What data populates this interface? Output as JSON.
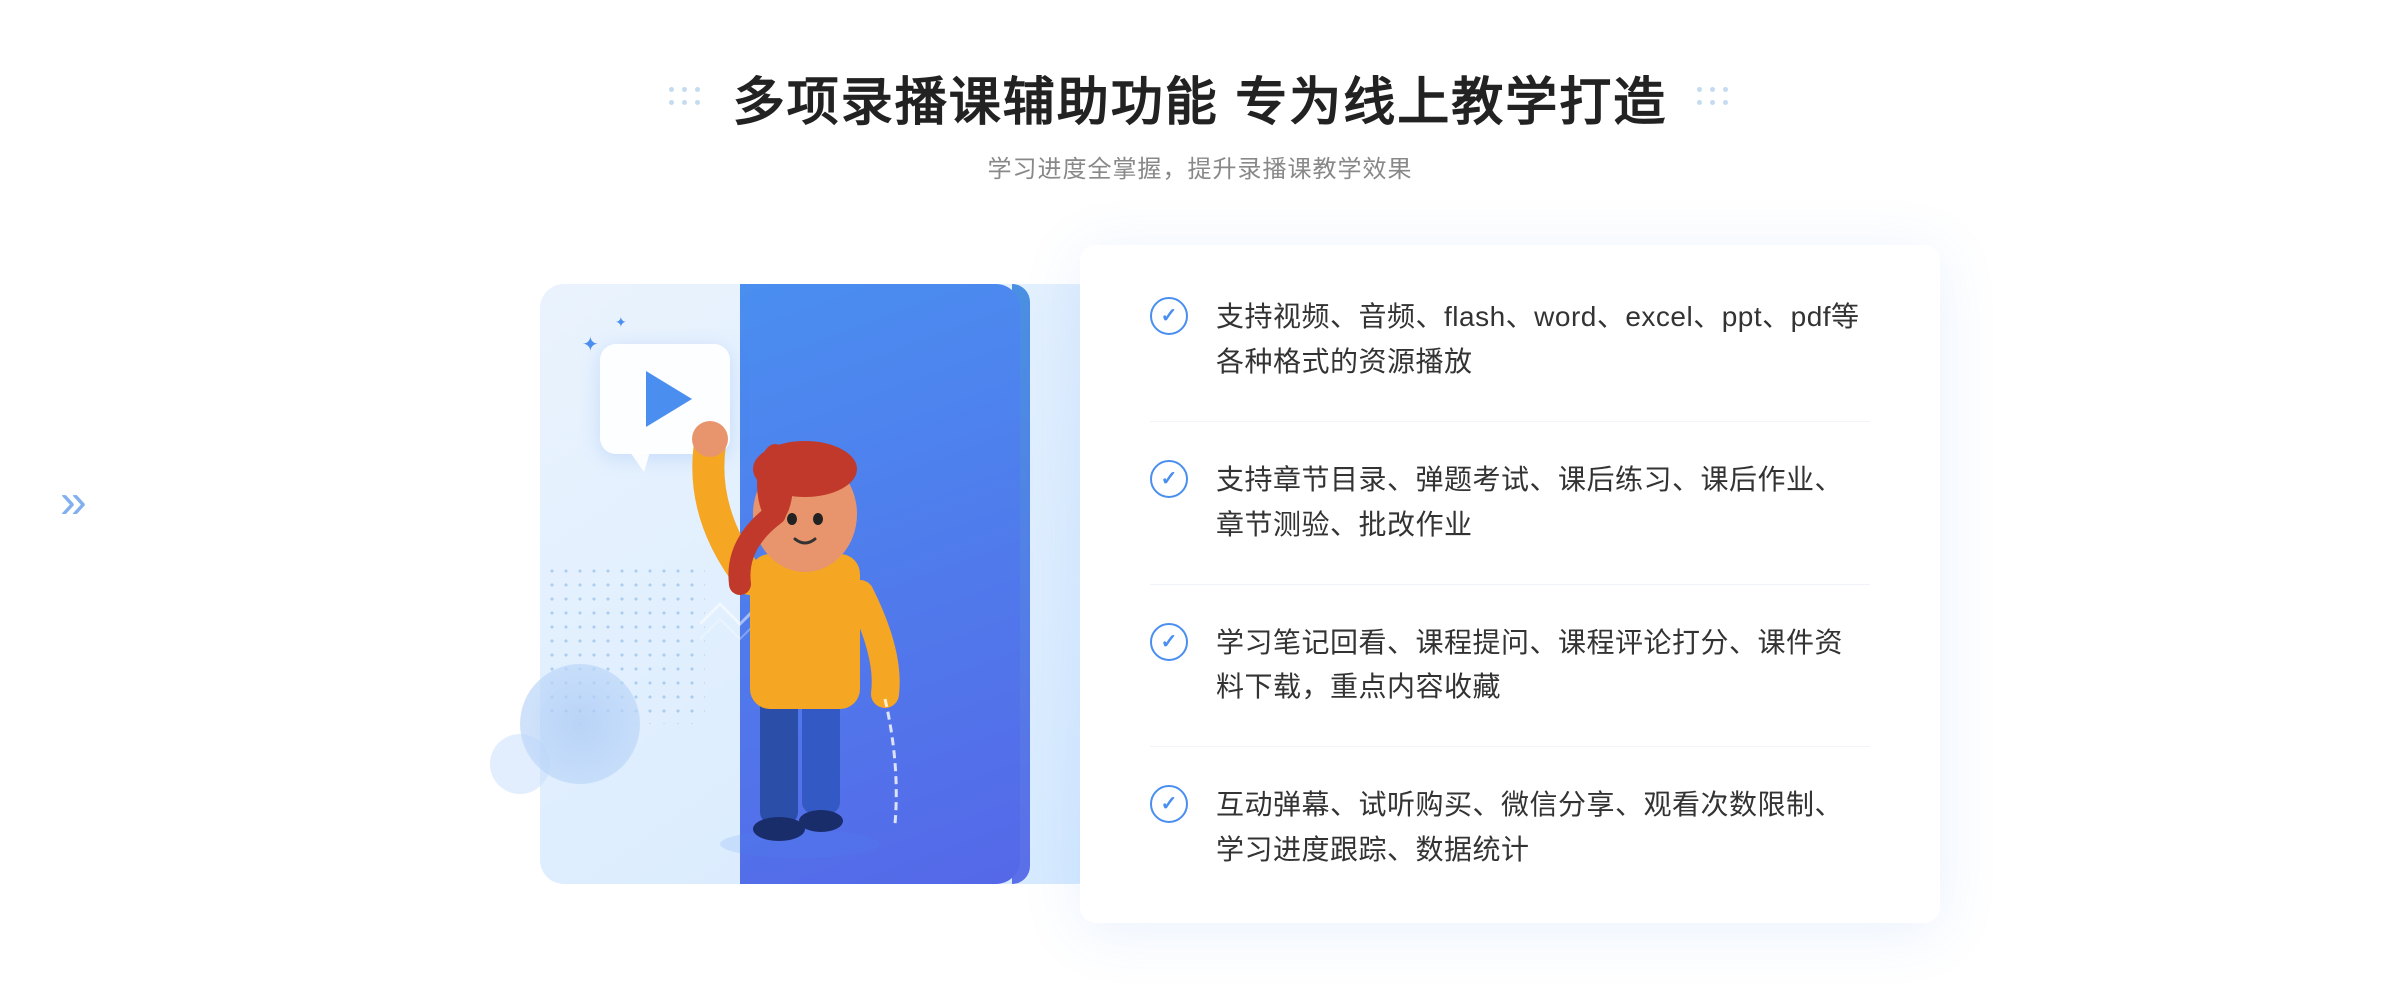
{
  "header": {
    "title": "多项录播课辅助功能 专为线上教学打造",
    "subtitle": "学习进度全掌握，提升录播课教学效果",
    "deco_left_aria": "decoration-dots-left",
    "deco_right_aria": "decoration-dots-right"
  },
  "features": [
    {
      "id": 1,
      "text": "支持视频、音频、flash、word、excel、ppt、pdf等各种格式的资源播放"
    },
    {
      "id": 2,
      "text": "支持章节目录、弹题考试、课后练习、课后作业、章节测验、批改作业"
    },
    {
      "id": 3,
      "text": "学习笔记回看、课程提问、课程评论打分、课件资料下载，重点内容收藏"
    },
    {
      "id": 4,
      "text": "互动弹幕、试听购买、微信分享、观看次数限制、学习进度跟踪、数据统计"
    }
  ],
  "chevron": "»",
  "colors": {
    "primary": "#4a8ef0",
    "secondary": "#5568e8",
    "text_dark": "#222",
    "text_light": "#888",
    "feature_text": "#333"
  }
}
